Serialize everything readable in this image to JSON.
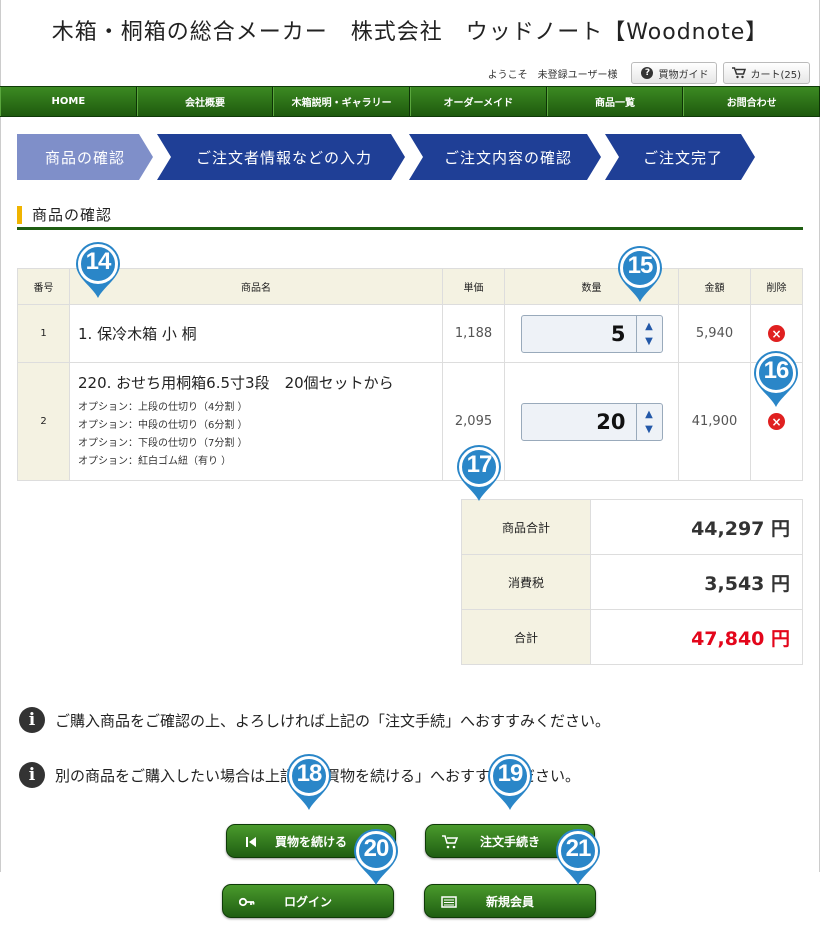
{
  "site": {
    "title": "木箱・桐箱の総合メーカー　株式会社　ウッドノート【Woodnote】"
  },
  "userbar": {
    "welcome": "ようこそ　未登録ユーザー様",
    "guide_label": "買物ガイド",
    "cart_label": "カート(25)"
  },
  "nav": [
    "HOME",
    "会社概要",
    "木箱説明・ギャラリー",
    "オーダーメイド",
    "商品一覧",
    "お問合わせ"
  ],
  "steps": [
    "商品の確認",
    "ご注文者情報などの入力",
    "ご注文内容の確認",
    "ご注文完了"
  ],
  "section": {
    "title": "商品の確認"
  },
  "cart": {
    "headers": {
      "no": "番号",
      "name": "商品名",
      "unit": "単価",
      "qty": "数量",
      "amount": "金額",
      "delete": "削除"
    },
    "rows": [
      {
        "no": "1",
        "name": "1. 保冷木箱 小 桐",
        "options": [],
        "unit": "1,188",
        "qty": "5",
        "amount": "5,940"
      },
      {
        "no": "2",
        "name": "220. おせち用桐箱6.5寸3段　20個セットから",
        "options": [
          "オプション：上段の仕切り（4分割 ）",
          "オプション：中段の仕切り（6分割 ）",
          "オプション：下段の仕切り（7分割 ）",
          "オプション：紅白ゴム紐（有り ）"
        ],
        "unit": "2,095",
        "qty": "20",
        "amount": "41,900"
      }
    ]
  },
  "totals": {
    "subtotal_label": "商品合計",
    "subtotal": "44,297 円",
    "tax_label": "消費税",
    "tax": "3,543 円",
    "total_label": "合計",
    "total": "47,840 円"
  },
  "notices": [
    "ご購入商品をご確認の上、よろしければ上記の「注文手続」へおすすみください。",
    "別の商品をご購入したい場合は上記の「買物を続ける」へおすすみください。"
  ],
  "buttons": {
    "continue": "買物を続ける",
    "checkout": "注文手続き",
    "login": "ログイン",
    "register": "新規会員"
  },
  "markers": [
    "14",
    "15",
    "16",
    "17",
    "18",
    "19",
    "20",
    "21"
  ],
  "colors": {
    "nav_green": "#1f5e12",
    "step_active": "#7f8fc9",
    "step_blue": "#1f3f96",
    "marker_blue": "#2a86c8",
    "total_red": "#e3061b",
    "heading_accent": "#f0b400"
  }
}
